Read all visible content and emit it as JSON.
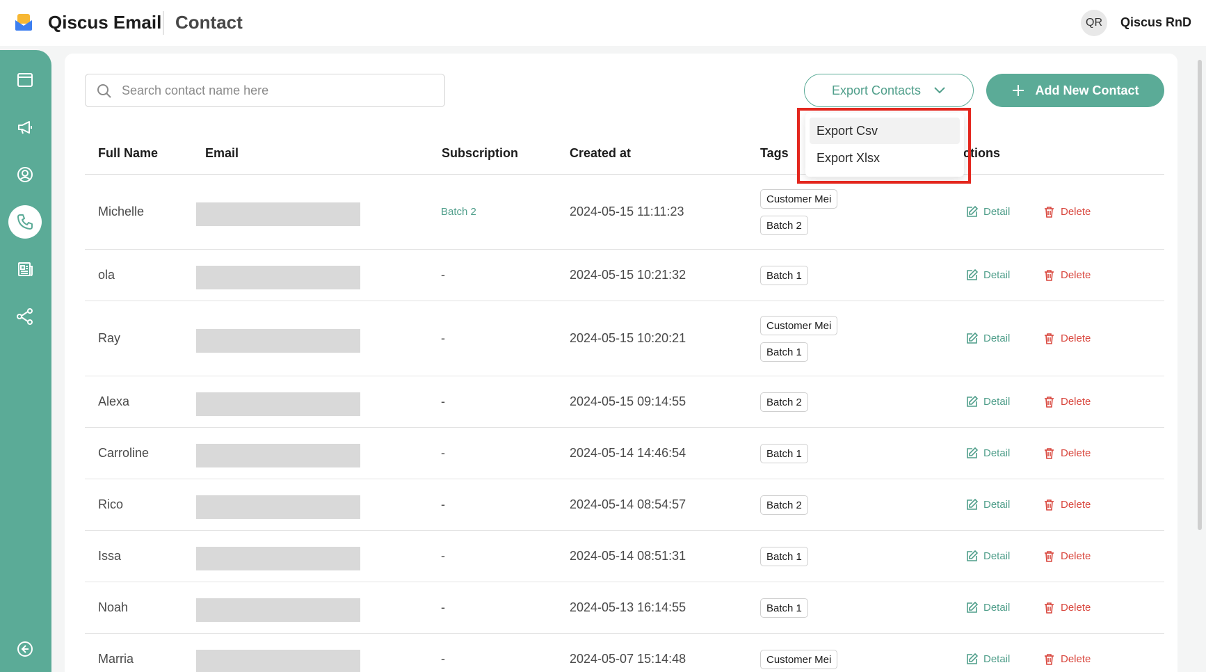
{
  "header": {
    "app_title": "Qiscus Email",
    "page_title": "Contact",
    "user_initials": "QR",
    "user_name": "Qiscus RnD"
  },
  "sidebar": {
    "items": [
      {
        "icon": "browser-window-icon",
        "active": false
      },
      {
        "icon": "megaphone-icon",
        "active": false
      },
      {
        "icon": "user-circle-icon",
        "active": false
      },
      {
        "icon": "phone-icon",
        "active": true
      },
      {
        "icon": "newspaper-icon",
        "active": false
      },
      {
        "icon": "share-nodes-icon",
        "active": false
      }
    ],
    "bottom_icon": "collapse-arrow-icon"
  },
  "toolbar": {
    "search_placeholder": "Search contact name here",
    "export_label": "Export Contacts",
    "add_label": "Add New Contact"
  },
  "export_menu": {
    "items": [
      "Export Csv",
      "Export Xlsx"
    ]
  },
  "table": {
    "columns": [
      "Full Name",
      "Email",
      "Subscription",
      "Created at",
      "Tags",
      "Actions"
    ],
    "detail_label": "Detail",
    "delete_label": "Delete",
    "rows": [
      {
        "name": "Michelle",
        "subscription": "Batch 2",
        "created_at": "2024-05-15 11:11:23",
        "tags": [
          "Customer Mei",
          "Batch 2"
        ]
      },
      {
        "name": "ola",
        "subscription": "-",
        "created_at": "2024-05-15 10:21:32",
        "tags": [
          "Batch 1"
        ]
      },
      {
        "name": "Ray",
        "subscription": "-",
        "created_at": "2024-05-15 10:20:21",
        "tags": [
          "Customer Mei",
          "Batch 1"
        ]
      },
      {
        "name": "Alexa",
        "subscription": "-",
        "created_at": "2024-05-15 09:14:55",
        "tags": [
          "Batch 2"
        ]
      },
      {
        "name": "Carroline",
        "subscription": "-",
        "created_at": "2024-05-14 14:46:54",
        "tags": [
          "Batch 1"
        ]
      },
      {
        "name": "Rico",
        "subscription": "-",
        "created_at": "2024-05-14 08:54:57",
        "tags": [
          "Batch 2"
        ]
      },
      {
        "name": "Issa",
        "subscription": "-",
        "created_at": "2024-05-14 08:51:31",
        "tags": [
          "Batch 1"
        ]
      },
      {
        "name": "Noah",
        "subscription": "-",
        "created_at": "2024-05-13 16:14:55",
        "tags": [
          "Batch 1"
        ]
      },
      {
        "name": "Marria",
        "subscription": "-",
        "created_at": "2024-05-07 15:14:48",
        "tags": [
          "Customer Mei"
        ]
      }
    ]
  },
  "colors": {
    "accent": "#5bab97",
    "accent_text": "#4f9e8a",
    "danger": "#d9473e",
    "highlight": "#e3261d"
  }
}
